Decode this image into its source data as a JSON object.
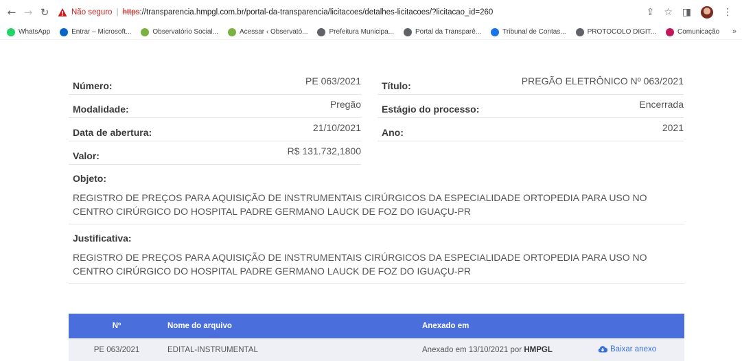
{
  "browser": {
    "not_secure": "Não seguro",
    "separator": "|",
    "url_scheme": "https",
    "url_rest": "://transparencia.hmpgl.com.br/portal-da-transparencia/licitacoes/detalhes-licitacoes/?licitacao_id=260",
    "bookmarks": [
      {
        "label": "WhatsApp",
        "color": "#25d366"
      },
      {
        "label": "Entrar – Microsoft...",
        "color": "#0a64c8"
      },
      {
        "label": "Observatório Social...",
        "color": "#7bb142"
      },
      {
        "label": "Acessar ‹ Observató...",
        "color": "#7bb142"
      },
      {
        "label": "Prefeitura Municipa...",
        "color": "#5f6368"
      },
      {
        "label": "Portal da Transparê...",
        "color": "#5f6368"
      },
      {
        "label": "Tribunal de Contas...",
        "color": "#1a73e8"
      },
      {
        "label": "PROTOCOLO DIGIT...",
        "color": "#5f6368"
      },
      {
        "label": "Comunicação",
        "color": "#c2185b"
      }
    ],
    "bookmarks_more": "»"
  },
  "details": {
    "left": [
      {
        "label": "Número:",
        "value": "PE 063/2021"
      },
      {
        "label": "Modalidade:",
        "value": "Pregão"
      },
      {
        "label": "Data de abertura:",
        "value": "21/10/2021"
      },
      {
        "label": "Valor:",
        "value": "R$ 131.732,1800"
      }
    ],
    "right": [
      {
        "label": "Título:",
        "value": "PREGÃO ELETRÔNICO Nº 063/2021"
      },
      {
        "label": "Estágio do processo:",
        "value": "Encerrada"
      },
      {
        "label": "Ano:",
        "value": "2021"
      }
    ],
    "objeto_label": "Objeto:",
    "objeto_text": "REGISTRO DE PREÇOS PARA AQUISIÇÃO DE INSTRUMENTAIS CIRÚRGICOS DA ESPECIALIDADE ORTOPEDIA PARA USO NO CENTRO CIRÚRGICO DO HOSPITAL PADRE GERMANO LAUCK DE FOZ DO IGUAÇU-PR",
    "justificativa_label": "Justificativa:",
    "justificativa_text": "REGISTRO DE PREÇOS PARA AQUISIÇÃO DE INSTRUMENTAIS CIRÚRGICOS DA ESPECIALIDADE ORTOPEDIA PARA USO NO CENTRO CIRÚRGICO DO HOSPITAL PADRE GERMANO LAUCK DE FOZ DO IGUAÇU-PR"
  },
  "files_table": {
    "headers": [
      "Nº",
      "Nome do arquivo",
      "Anexado em",
      ""
    ],
    "header_color": "#4a6fdc",
    "rows": [
      {
        "numero": "PE 063/2021",
        "arquivo": "EDITAL-INSTRUMENTAL",
        "anexado_prefix": "Anexado em 13/10/2021 por ",
        "anexado_user": "HMPGL",
        "download": "Baixar anexo"
      }
    ]
  }
}
